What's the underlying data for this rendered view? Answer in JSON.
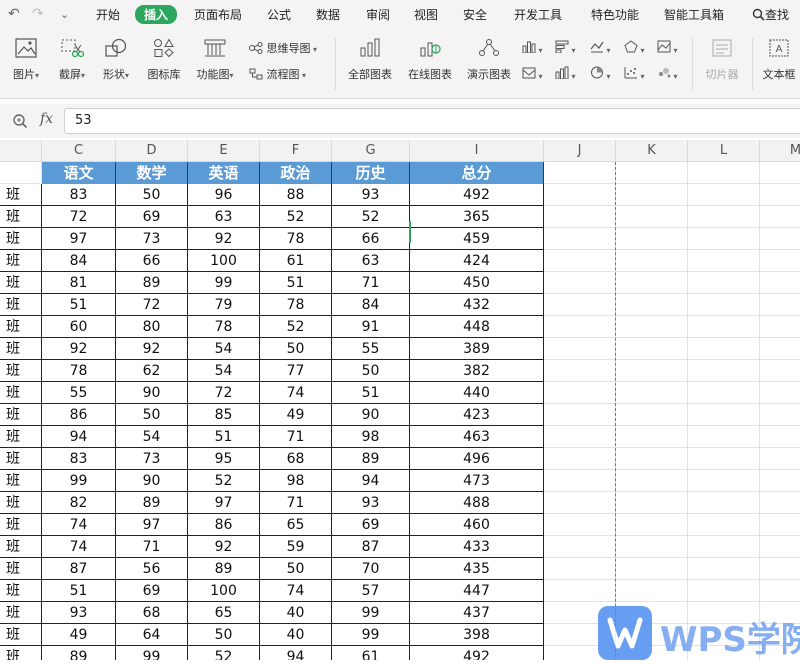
{
  "quick_access": {
    "undo": "↶",
    "redo": "↷",
    "more": "⌄"
  },
  "menu": [
    "开始",
    "插入",
    "页面布局",
    "公式",
    "数据",
    "审阅",
    "视图",
    "安全",
    "开发工具",
    "特色功能",
    "智能工具箱"
  ],
  "menu_active": "插入",
  "search_label": "查找",
  "ribbon": {
    "picture": "图片",
    "screenshot": "截屏",
    "shape": "形状",
    "icon_lib": "图标库",
    "func_chart": "功能图",
    "mind_map": "思维导图",
    "flowchart": "流程图",
    "all_charts": "全部图表",
    "online_chart": "在线图表",
    "demo_chart": "演示图表",
    "slicer": "切片器",
    "textbox": "文本框"
  },
  "formula_bar": {
    "value": "53"
  },
  "columns": [
    "C",
    "D",
    "E",
    "F",
    "G",
    "I",
    "J",
    "K",
    "L",
    "M"
  ],
  "table": {
    "headers": [
      "语文",
      "数学",
      "英语",
      "政治",
      "历史",
      "总分"
    ],
    "row_label": "班",
    "rows": [
      [
        "83",
        "50",
        "96",
        "88",
        "93",
        "492"
      ],
      [
        "72",
        "69",
        "63",
        "52",
        "52",
        "365"
      ],
      [
        "97",
        "73",
        "92",
        "78",
        "66",
        "459"
      ],
      [
        "84",
        "66",
        "100",
        "61",
        "63",
        "424"
      ],
      [
        "81",
        "89",
        "99",
        "51",
        "71",
        "450"
      ],
      [
        "51",
        "72",
        "79",
        "78",
        "84",
        "432"
      ],
      [
        "60",
        "80",
        "78",
        "52",
        "91",
        "448"
      ],
      [
        "92",
        "92",
        "54",
        "50",
        "55",
        "389"
      ],
      [
        "78",
        "62",
        "54",
        "77",
        "50",
        "382"
      ],
      [
        "55",
        "90",
        "72",
        "74",
        "51",
        "440"
      ],
      [
        "86",
        "50",
        "85",
        "49",
        "90",
        "423"
      ],
      [
        "94",
        "54",
        "51",
        "71",
        "98",
        "463"
      ],
      [
        "83",
        "73",
        "95",
        "68",
        "89",
        "496"
      ],
      [
        "99",
        "90",
        "52",
        "98",
        "94",
        "473"
      ],
      [
        "82",
        "89",
        "97",
        "71",
        "93",
        "488"
      ],
      [
        "74",
        "97",
        "86",
        "65",
        "69",
        "460"
      ],
      [
        "74",
        "71",
        "92",
        "59",
        "87",
        "433"
      ],
      [
        "87",
        "56",
        "89",
        "50",
        "70",
        "435"
      ],
      [
        "51",
        "69",
        "100",
        "74",
        "57",
        "447"
      ],
      [
        "93",
        "68",
        "65",
        "40",
        "99",
        "437"
      ],
      [
        "49",
        "64",
        "50",
        "40",
        "99",
        "398"
      ],
      [
        "89",
        "99",
        "52",
        "94",
        "61",
        "492"
      ]
    ]
  },
  "watermark": {
    "text": "WPS学院"
  },
  "colors": {
    "accent": "#2da760",
    "header_fill": "#5b9bd5",
    "watermark": "#4d8ef0"
  }
}
